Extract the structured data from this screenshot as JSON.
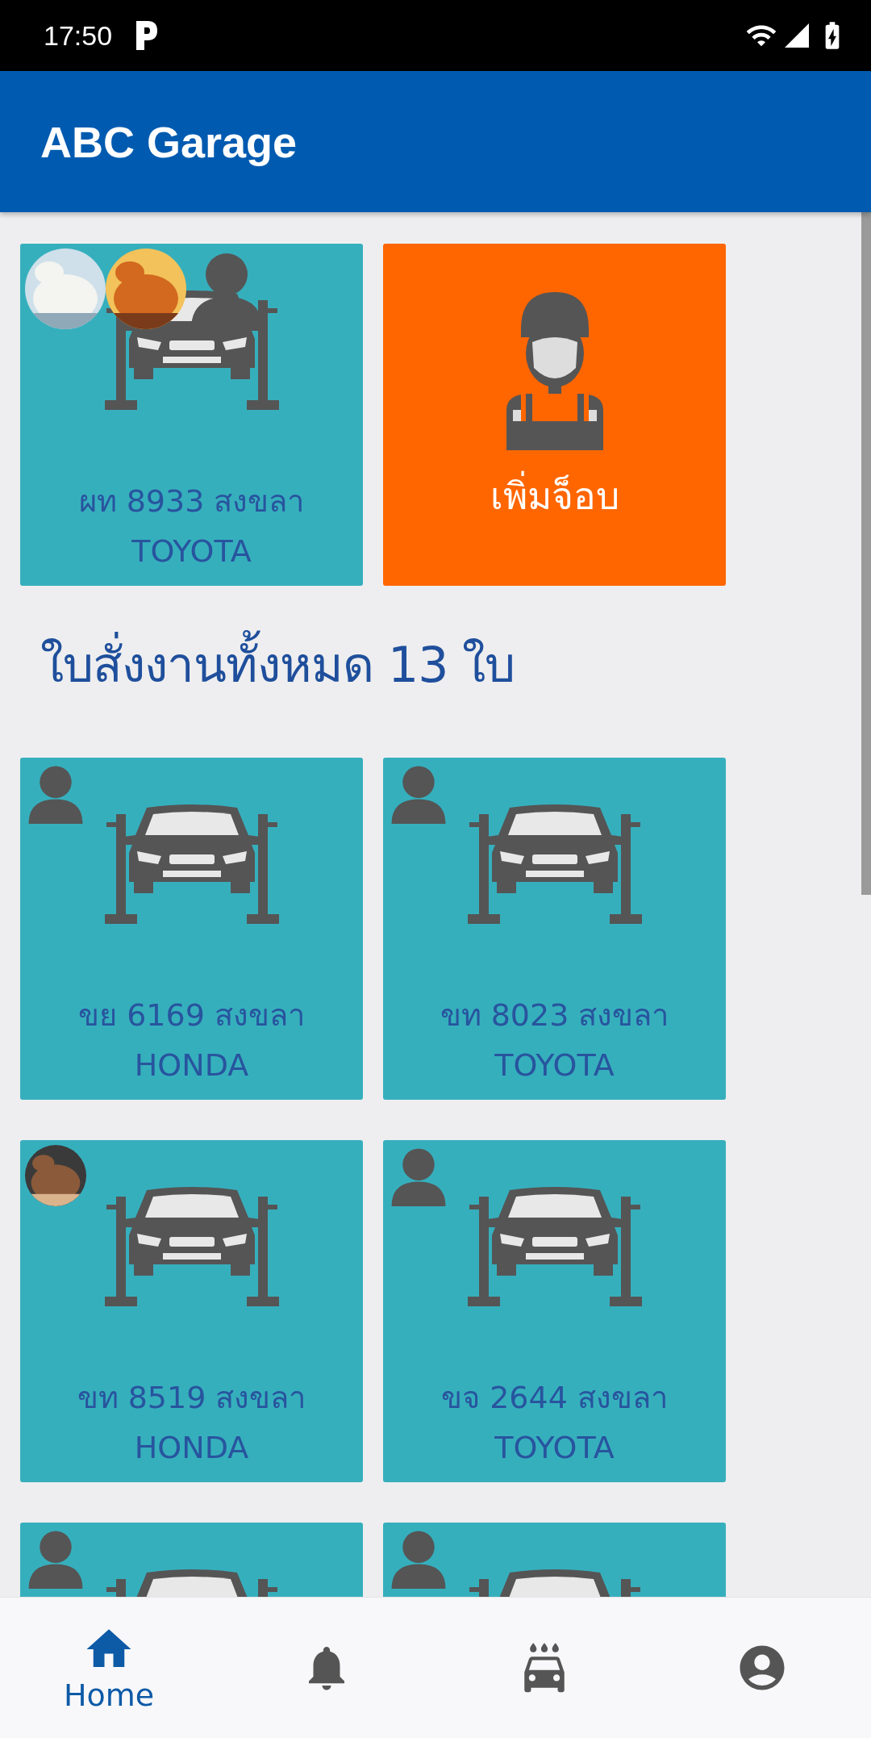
{
  "status_bar": {
    "time": "17:50"
  },
  "app_bar": {
    "title": "ABC Garage"
  },
  "active_jobs": [
    {
      "plate": "ผท 8933 สงขลา",
      "brand": "TOYOTA",
      "assignees": [
        {
          "kind": "picture"
        },
        {
          "kind": "picture"
        },
        {
          "kind": "person"
        }
      ]
    }
  ],
  "add_job": {
    "label": "เพิ่มจ็อบ"
  },
  "orders_heading": "ใบสั่งงานทั้งหมด 13 ใบ",
  "orders": [
    {
      "plate": "ขย 6169 สงขลา",
      "brand": "HONDA",
      "assignees": [
        {
          "kind": "person"
        }
      ]
    },
    {
      "plate": "ขท 8023 สงขลา",
      "brand": "TOYOTA",
      "assignees": [
        {
          "kind": "person"
        }
      ]
    },
    {
      "plate": "ขท 8519 สงขลา",
      "brand": "HONDA",
      "assignees": [
        {
          "kind": "picture"
        }
      ]
    },
    {
      "plate": "ขจ 2644 สงขลา",
      "brand": "TOYOTA",
      "assignees": [
        {
          "kind": "person"
        }
      ]
    },
    {
      "assignees": [
        {
          "kind": "person"
        }
      ]
    },
    {
      "assignees": [
        {
          "kind": "person"
        }
      ]
    }
  ],
  "bottom_nav": [
    {
      "kind": "home",
      "label": "Home",
      "selected": true
    },
    {
      "kind": "bell",
      "selected": false
    },
    {
      "kind": "carwash",
      "selected": false
    },
    {
      "kind": "account",
      "selected": false
    }
  ]
}
